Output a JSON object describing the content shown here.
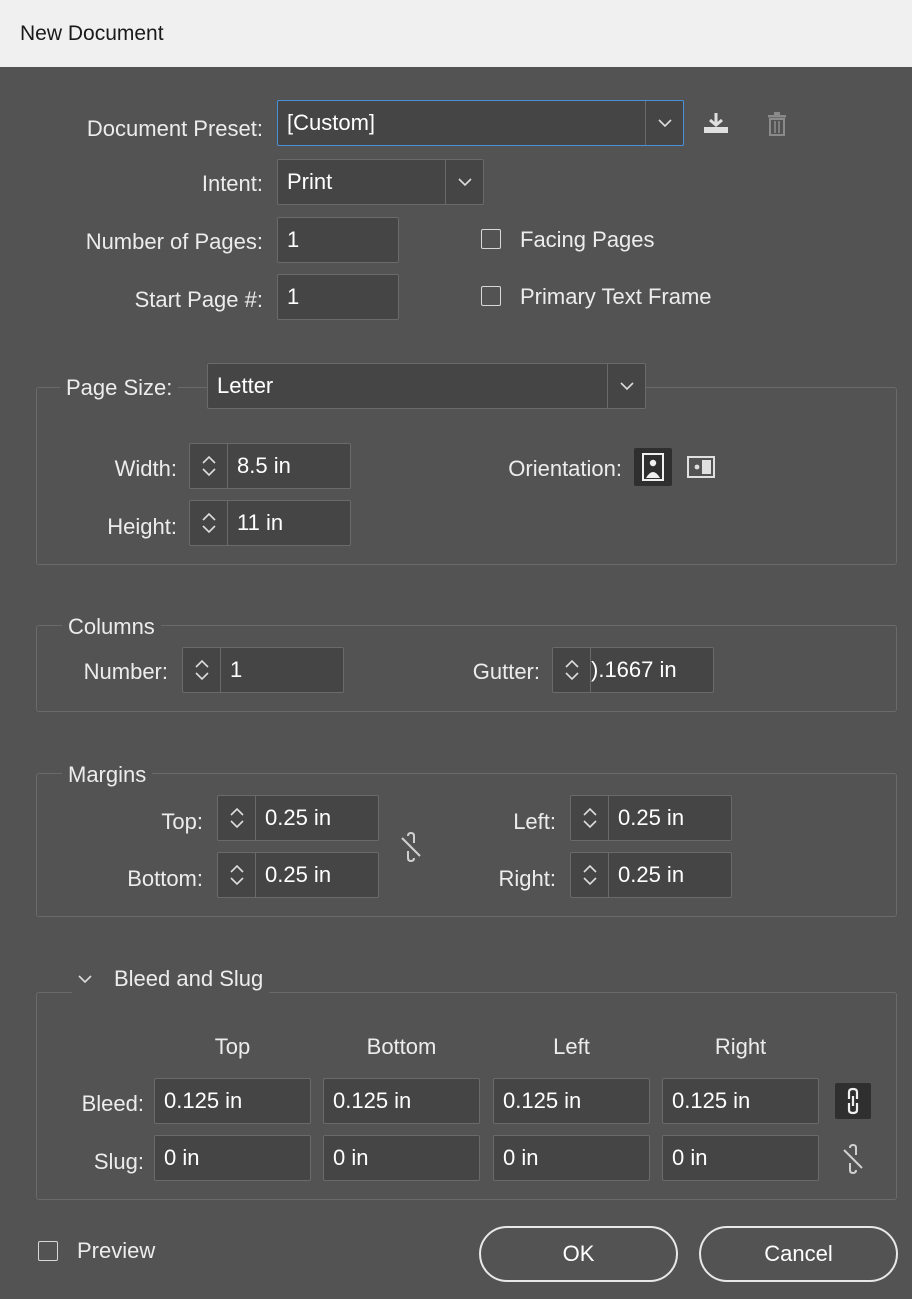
{
  "window": {
    "title": "New Document"
  },
  "preset": {
    "label": "Document Preset:",
    "value": "[Custom]"
  },
  "intent": {
    "label": "Intent:",
    "value": "Print"
  },
  "pages": {
    "number_label": "Number of Pages:",
    "number_value": "1",
    "start_label": "Start Page #:",
    "start_value": "1",
    "facing_label": "Facing Pages",
    "primary_label": "Primary Text Frame"
  },
  "page_size": {
    "label": "Page Size:",
    "value": "Letter",
    "width_label": "Width:",
    "width_value": "8.5 in",
    "height_label": "Height:",
    "height_value": "11 in",
    "orientation_label": "Orientation:"
  },
  "columns": {
    "title": "Columns",
    "number_label": "Number:",
    "number_value": "1",
    "gutter_label": "Gutter:",
    "gutter_value": ").1667 in"
  },
  "margins": {
    "title": "Margins",
    "top_label": "Top:",
    "top_value": "0.25 in",
    "bottom_label": "Bottom:",
    "bottom_value": "0.25 in",
    "left_label": "Left:",
    "left_value": "0.25 in",
    "right_label": "Right:",
    "right_value": "0.25 in"
  },
  "bleed_slug": {
    "title": "Bleed and Slug",
    "headers": [
      "Top",
      "Bottom",
      "Left",
      "Right"
    ],
    "bleed_label": "Bleed:",
    "bleed_values": [
      "0.125 in",
      "0.125 in",
      "0.125 in",
      "0.125 in"
    ],
    "slug_label": "Slug:",
    "slug_values": [
      "0 in",
      "0 in",
      "0 in",
      "0 in"
    ]
  },
  "footer": {
    "preview_label": "Preview",
    "ok_label": "OK",
    "cancel_label": "Cancel"
  },
  "colors": {
    "dialog_bg": "#535353",
    "field_bg": "#454545",
    "focus": "#4a8fd9",
    "titlebar_bg": "#f0f0f0"
  }
}
